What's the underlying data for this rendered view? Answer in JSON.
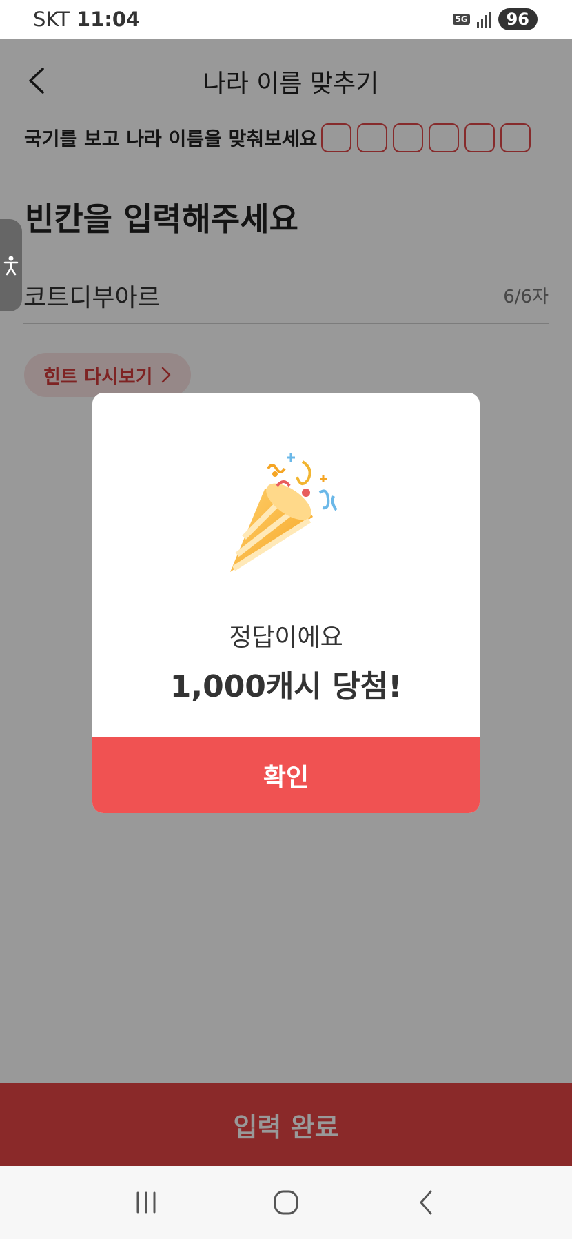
{
  "status_bar": {
    "carrier": "SKT",
    "time": "11:04",
    "network": "5G",
    "battery": "96"
  },
  "header": {
    "title": "나라 이름 맞추기"
  },
  "quiz": {
    "instruction": "국기를 보고 나라 이름을 맞춰보세요",
    "answer_box_count": 6,
    "section_title": "빈칸을 입력해주세요",
    "input_value": "코트디부아르",
    "char_counter": "6/6자",
    "hint_label": "힌트 다시보기"
  },
  "submit": {
    "label": "입력 완료"
  },
  "modal": {
    "illustration": "party-popper-icon",
    "subtitle": "정답이에요",
    "title": "1,000캐시 당첨!",
    "confirm_label": "확인"
  },
  "colors": {
    "accent": "#f05252",
    "answer_box_border": "#e0494a",
    "hint_bg": "#fbe3e3"
  }
}
